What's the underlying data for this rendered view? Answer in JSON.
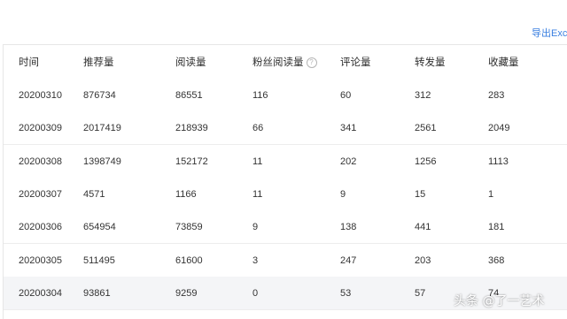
{
  "toolbar": {
    "export_label": "导出Exce"
  },
  "table": {
    "headers": [
      "时间",
      "推荐量",
      "阅读量",
      "粉丝阅读量",
      "评论量",
      "转发量",
      "收藏量"
    ],
    "help_icon_glyph": "?",
    "rows": [
      [
        "20200310",
        "876734",
        "86551",
        "116",
        "60",
        "312",
        "283"
      ],
      [
        "20200309",
        "2017419",
        "218939",
        "66",
        "341",
        "2561",
        "2049"
      ],
      [
        "20200308",
        "1398749",
        "152172",
        "11",
        "202",
        "1256",
        "1113"
      ],
      [
        "20200307",
        "4571",
        "1166",
        "11",
        "9",
        "15",
        "1"
      ],
      [
        "20200306",
        "654954",
        "73859",
        "9",
        "138",
        "441",
        "181"
      ],
      [
        "20200305",
        "511495",
        "61600",
        "3",
        "247",
        "203",
        "368"
      ],
      [
        "20200304",
        "93861",
        "9259",
        "0",
        "53",
        "57",
        "74"
      ]
    ]
  },
  "watermark": "头条 @了一艺术",
  "colors": {
    "link": "#3a7fe0",
    "row_hover": "#f4f5f7",
    "border": "#e8e8e8"
  }
}
